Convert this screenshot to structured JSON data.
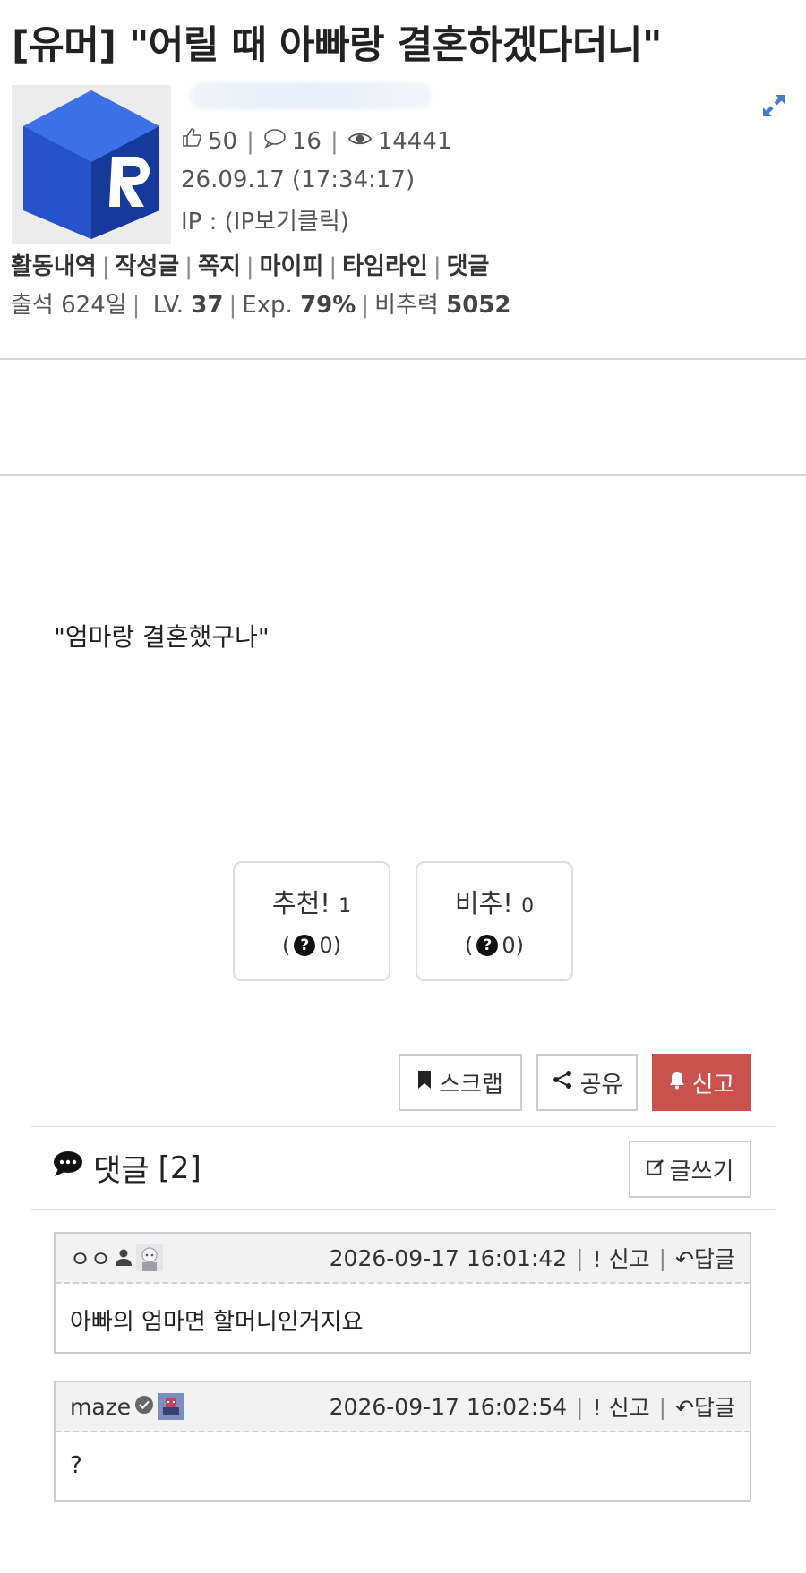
{
  "post": {
    "title": "[유머] \"어릴 때 아빠랑 결혼하겠다더니\"",
    "likes": "50",
    "comments": "16",
    "views": "14441",
    "date": "26.09.17 (17:34:17)",
    "ip": "IP : (IP보기클릭)",
    "body": "\"엄마랑 결혼했구나\""
  },
  "author": {
    "links": [
      "활동내역",
      "작성글",
      "쪽지",
      "마이피",
      "타임라인",
      "댓글"
    ],
    "attendance_label": "출석 624일",
    "lv_label": "LV.",
    "lv_value": "37",
    "exp_label": "Exp.",
    "exp_value": "79%",
    "power_label": "비추력",
    "power_value": "5052"
  },
  "votes": {
    "up_label": "추천!",
    "up_count": "1",
    "up_sub": "0)",
    "down_label": "비추!",
    "down_count": "0",
    "down_sub": "0)"
  },
  "actions": {
    "scrap": "스크랩",
    "share": "공유",
    "report": "신고"
  },
  "comments_section": {
    "title": "댓글",
    "count": "[2]",
    "write": "글쓰기",
    "items": [
      {
        "name": "ㅇㅇ",
        "time": "2026-09-17 16:01:42",
        "report": "신고",
        "reply": "답글",
        "text": "아빠의 엄마면 할머니인거지요"
      },
      {
        "name": "maze",
        "time": "2026-09-17 16:02:54",
        "report": "신고",
        "reply": "답글",
        "text": "?"
      }
    ]
  },
  "colors": {
    "report_red": "#c9524f",
    "logo_blue": "#1f4fc4",
    "expand_blue": "#4a78c8"
  }
}
